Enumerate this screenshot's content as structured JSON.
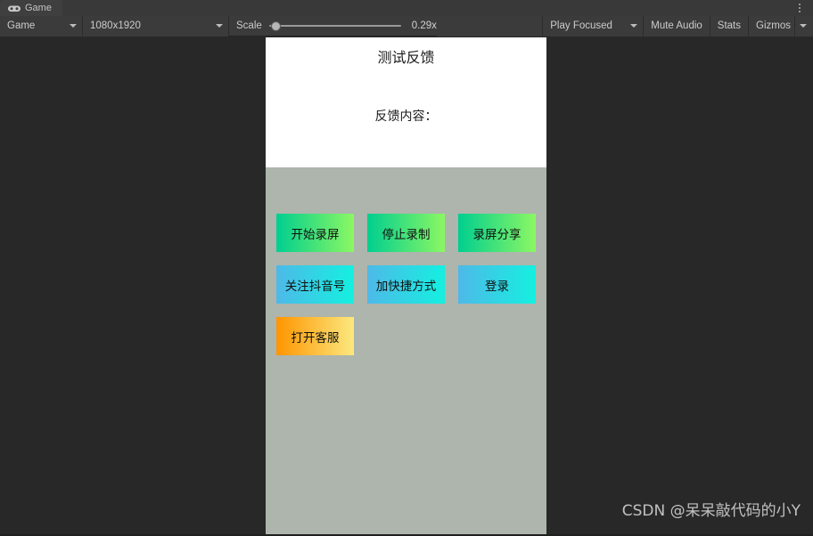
{
  "window": {
    "background_color": "#282828"
  },
  "tab_bar": {
    "tabs": [
      {
        "label": "Game",
        "icon": "gamepad-icon",
        "active": true
      }
    ],
    "menu_icon": "kebab-menu-icon"
  },
  "toolbar": {
    "display_dropdown": {
      "value": "Game"
    },
    "resolution_dropdown": {
      "value": "1080x1920"
    },
    "scale": {
      "label": "Scale",
      "value": "0.29x",
      "slider_position_pct": 2
    },
    "play_mode_dropdown": {
      "value": "Play Focused"
    },
    "mute_audio_button": "Mute Audio",
    "stats_button": "Stats",
    "gizmos_button": "Gizmos"
  },
  "game_view": {
    "canvas_background": "#adb5ad",
    "panel": {
      "background": "#ffffff",
      "title": "测试反馈",
      "subtitle": "反馈内容："
    },
    "buttons": {
      "rows": [
        [
          {
            "label": "开始录屏",
            "style": "btn-green"
          },
          {
            "label": "停止录制",
            "style": "btn-green"
          },
          {
            "label": "录屏分享",
            "style": "btn-green"
          }
        ],
        [
          {
            "label": "关注抖音号",
            "style": "btn-blue"
          },
          {
            "label": "加快捷方式",
            "style": "btn-blue"
          },
          {
            "label": "登录",
            "style": "btn-blue"
          }
        ],
        [
          {
            "label": "打开客服",
            "style": "btn-orange"
          }
        ]
      ]
    },
    "watermark": "CSDN @呆呆敲代码的小Y"
  },
  "colors": {
    "toolbar_bg": "#3b3b3b",
    "tab_active_bg": "#3f3f3f",
    "text": "#cccccc",
    "green_gradient_start": "#00cf8f",
    "green_gradient_end": "#8cf763",
    "blue_gradient_start": "#4eb9e8",
    "blue_gradient_end": "#14f0e0",
    "orange_gradient_start": "#ff9500",
    "orange_gradient_end": "#fbe87f"
  }
}
